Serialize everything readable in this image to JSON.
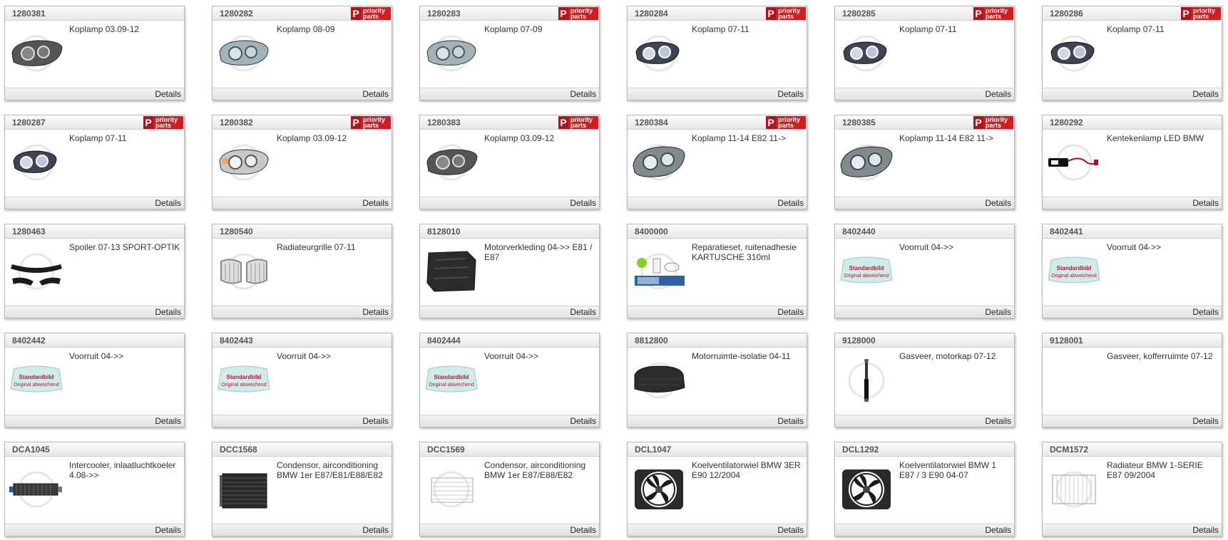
{
  "priority_badge": {
    "letter": "P",
    "line1": "priority",
    "line2": "parts"
  },
  "details_label": "Details",
  "colors": {
    "badge_red": "#d71920",
    "border": "#b9b9b9"
  },
  "cards": [
    {
      "art": "1280381",
      "desc": "Koplamp 03.09-12",
      "priority": false,
      "icon": "headlamp-dark-icon"
    },
    {
      "art": "1280282",
      "desc": "Koplamp 08-09",
      "priority": true,
      "icon": "headlamp-clear-icon"
    },
    {
      "art": "1280283",
      "desc": "Koplamp 07-09",
      "priority": true,
      "icon": "headlamp-clear-icon"
    },
    {
      "art": "1280284",
      "desc": "Koplamp 07-11",
      "priority": true,
      "icon": "headlamp-projector-icon"
    },
    {
      "art": "1280285",
      "desc": "Koplamp 07-11",
      "priority": true,
      "icon": "headlamp-projector-icon"
    },
    {
      "art": "1280286",
      "desc": "Koplamp 07-11",
      "priority": true,
      "icon": "headlamp-projector-icon"
    },
    {
      "art": "1280287",
      "desc": "Koplamp 07-11",
      "priority": true,
      "icon": "headlamp-projector-icon"
    },
    {
      "art": "1280382",
      "desc": "Koplamp 03.09-12",
      "priority": true,
      "icon": "headlamp-amber-icon"
    },
    {
      "art": "1280383",
      "desc": "Koplamp 03.09-12",
      "priority": true,
      "icon": "headlamp-dark-icon"
    },
    {
      "art": "1280384",
      "desc": "Koplamp 11-14 E82 11->",
      "priority": true,
      "icon": "headlamp-xenon-icon"
    },
    {
      "art": "1280385",
      "desc": "Koplamp 11-14 E82 11->",
      "priority": true,
      "icon": "headlamp-xenon-icon"
    },
    {
      "art": "1280292",
      "desc": "Kentekenlamp LED BMW",
      "priority": false,
      "icon": "license-lamp-icon"
    },
    {
      "art": "1280463",
      "desc": "Spoiler 07-13 SPORT-OPTIK",
      "priority": false,
      "icon": "spoiler-icon"
    },
    {
      "art": "1280540",
      "desc": "Radiateurgrille 07-11",
      "priority": false,
      "icon": "grille-icon"
    },
    {
      "art": "8128010",
      "desc": "Motorverkleding 04->> E81 / E87",
      "priority": false,
      "icon": "engine-cover-icon"
    },
    {
      "art": "8400000",
      "desc": "Reparatieset, ruitenadhesie KARTUSCHE 310ml",
      "priority": false,
      "icon": "repair-kit-icon"
    },
    {
      "art": "8402440",
      "desc": "Voorruit 04->>",
      "priority": false,
      "icon": "windshield-icon"
    },
    {
      "art": "8402441",
      "desc": "Voorruit 04->>",
      "priority": false,
      "icon": "windshield-icon"
    },
    {
      "art": "8402442",
      "desc": "Voorruit 04->>",
      "priority": false,
      "icon": "windshield-icon"
    },
    {
      "art": "8402443",
      "desc": "Voorruit 04->>",
      "priority": false,
      "icon": "windshield-icon"
    },
    {
      "art": "8402444",
      "desc": "Voorruit 04->>",
      "priority": false,
      "icon": "windshield-icon"
    },
    {
      "art": "8812800",
      "desc": "Motorruimte-isolatie 04-11",
      "priority": false,
      "icon": "insulation-pad-icon"
    },
    {
      "art": "9128000",
      "desc": "Gasveer, motorkap 07-12",
      "priority": false,
      "icon": "gas-spring-icon"
    },
    {
      "art": "9128001",
      "desc": "Gasveer, kofferruimte 07-12",
      "priority": false,
      "icon": "none"
    },
    {
      "art": "DCA1045",
      "desc": "Intercooler, inlaatluchtkoeler 4.08->>",
      "priority": false,
      "icon": "intercooler-icon"
    },
    {
      "art": "DCC1568",
      "desc": "Condensor, airconditioning BMW 1er E87/E81/E88/E82",
      "priority": false,
      "icon": "condenser-icon"
    },
    {
      "art": "DCC1569",
      "desc": "Condensor, airconditioning BMW 1er E87/E88/E82",
      "priority": false,
      "icon": "condenser-outline-icon"
    },
    {
      "art": "DCL1047",
      "desc": "Koelventilatorwiel BMW 3ER E90 12/2004",
      "priority": false,
      "icon": "fan-icon"
    },
    {
      "art": "DCL1292",
      "desc": "Koelventilatorwiel BMW 1 E87 / 3 E90 04-07",
      "priority": false,
      "icon": "fan-icon"
    },
    {
      "art": "DCM1572",
      "desc": "Radiateur BMW 1-SERIE E87 09/2004",
      "priority": false,
      "icon": "radiator-outline-icon"
    }
  ],
  "standard_image": {
    "line1": "Standardbild",
    "line2": "Original abweichend"
  }
}
